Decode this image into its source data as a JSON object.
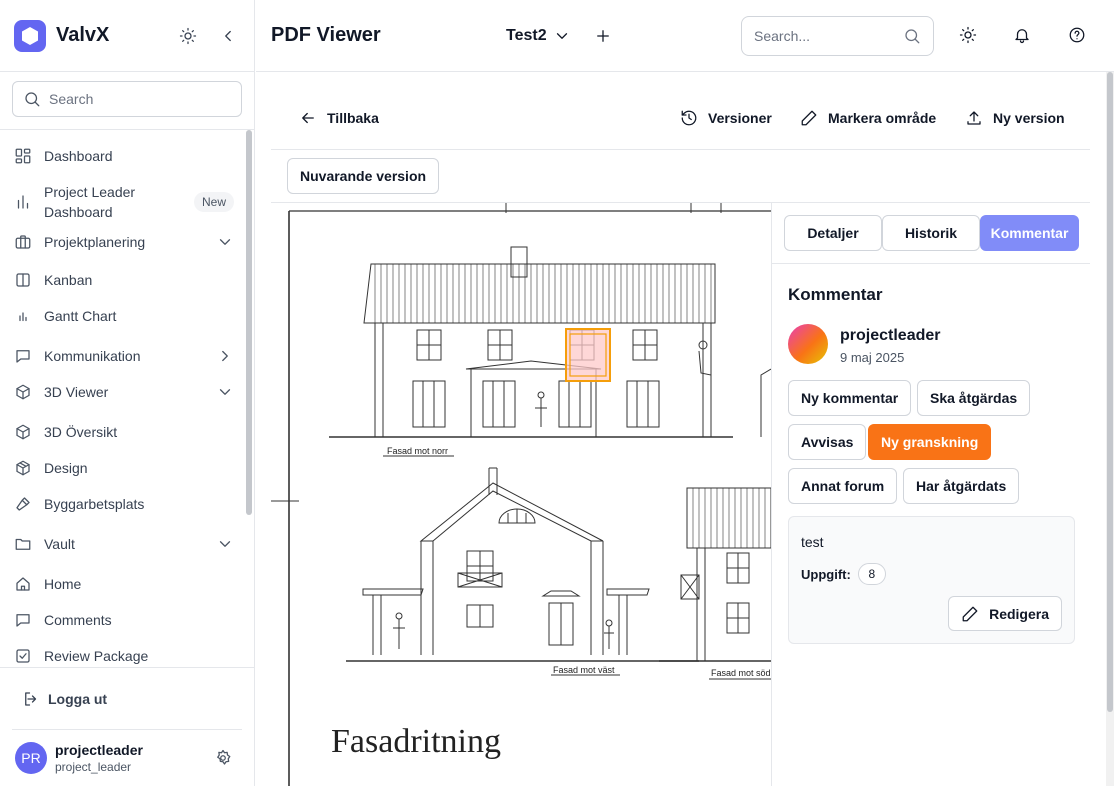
{
  "app": {
    "brand": "ValvX"
  },
  "sidebar": {
    "search_placeholder": "Search",
    "items": [
      {
        "label": "Dashboard",
        "icon": "dashboard-icon"
      },
      {
        "label": "Project Leader Dashboard",
        "icon": "bar-chart-icon",
        "badge": "New"
      },
      {
        "label": "Projektplanering",
        "icon": "briefcase-icon",
        "chevron": "down"
      },
      {
        "label": "Kanban",
        "icon": "kanban-icon"
      },
      {
        "label": "Gantt Chart",
        "icon": "gantt-icon"
      },
      {
        "label": "Kommunikation",
        "icon": "message-icon",
        "chevron": "right"
      },
      {
        "label": "3D Viewer",
        "icon": "cube-icon",
        "chevron": "down"
      },
      {
        "label": "3D Översikt",
        "icon": "cube-icon"
      },
      {
        "label": "Design",
        "icon": "package-icon"
      },
      {
        "label": "Byggarbetsplats",
        "icon": "hammer-icon"
      },
      {
        "label": "Vault",
        "icon": "folder-icon",
        "chevron": "down"
      },
      {
        "label": "Home",
        "icon": "home-icon"
      },
      {
        "label": "Comments",
        "icon": "comment-icon"
      },
      {
        "label": "Review Package",
        "icon": "check-square-icon"
      }
    ],
    "logout_label": "Logga ut",
    "user": {
      "initials": "PR",
      "name": "projectleader",
      "handle": "project_leader"
    }
  },
  "topbar": {
    "title": "PDF Viewer",
    "project": "Test2",
    "search_placeholder": "Search..."
  },
  "toolbar": {
    "back_label": "Tillbaka",
    "versions_label": "Versioner",
    "mark_label": "Markera område",
    "new_version_label": "Ny version",
    "current_version_label": "Nuvarande version"
  },
  "drawing": {
    "label_north": "Fasad mot norr",
    "label_west": "Fasad mot väst",
    "label_south": "Fasad mot söd",
    "title": "Fasadritning"
  },
  "panel": {
    "tabs": [
      "Detaljer",
      "Historik",
      "Kommentar"
    ],
    "active_tab": "Kommentar",
    "title": "Kommentar",
    "author": "projectleader",
    "date": "9 maj 2025",
    "statuses": [
      "Ny kommentar",
      "Ska åtgärdas",
      "Avvisas",
      "Ny granskning",
      "Annat forum",
      "Har åtgärdats"
    ],
    "active_status": "Ny granskning",
    "comment_text": "test",
    "task_label": "Uppgift:",
    "task_number": "8",
    "edit_label": "Redigera"
  },
  "colors": {
    "accent": "#6366f1",
    "tab_active": "#818cf8",
    "status_active": "#f97316",
    "highlight": "#f59e0b"
  }
}
